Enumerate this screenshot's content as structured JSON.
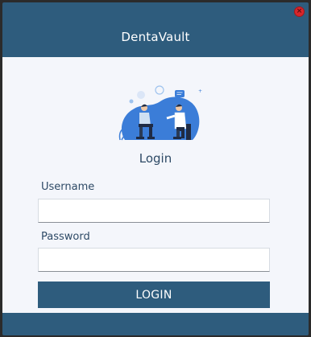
{
  "window": {
    "title": "DentaVault",
    "close_icon": "close-icon"
  },
  "login": {
    "heading": "Login",
    "illustration_icon": "consultation-illustration",
    "username_label": "Username",
    "username_value": "",
    "password_label": "Password",
    "password_value": "",
    "button_label": "LOGIN"
  },
  "colors": {
    "primary": "#2e5c7d",
    "panel_bg": "#f4f6fb",
    "close_red": "#d7262b",
    "text_dark": "#2e4a66"
  }
}
